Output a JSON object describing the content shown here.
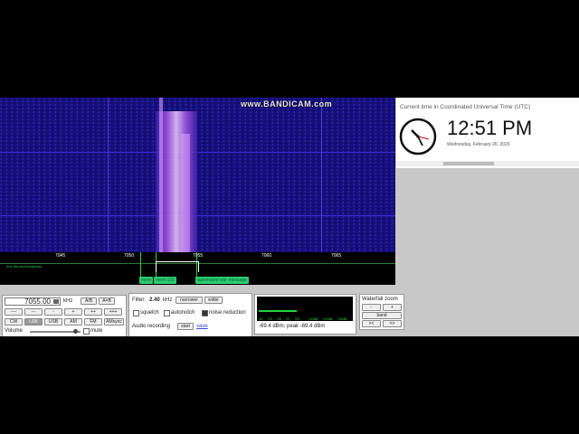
{
  "watermark": "www.BANDICAM.com",
  "frequency_scale": {
    "ticks": [
      "7045",
      "7050",
      "7055",
      "7060",
      "7065"
    ],
    "dx_label": "4ns Illinoind Amateurs"
  },
  "markers": {
    "mem1": "mem",
    "mem2": "mem 120",
    "war": "automated war message"
  },
  "clock": {
    "title": "Current time in Coordinated Universal Time (UTC)",
    "time": "12:51 PM",
    "date": "Wednesday, February 26, 2020"
  },
  "controls": {
    "frequency_value": "7055.00",
    "unit": "kHz",
    "ab": "A/B",
    "a_eq_b": "A=B",
    "step_buttons": [
      "----",
      "---",
      "-",
      "+",
      "++",
      "+++"
    ],
    "modes": [
      "CW",
      "LSB",
      "USB",
      "AM",
      "FM",
      "AMsync"
    ],
    "active_mode": "LSB",
    "volume_label": "Volume",
    "volume_level": 0.95,
    "mute_label": "mute"
  },
  "filter": {
    "label": "Filter:",
    "bandwidth": "2.40",
    "unit": "kHz",
    "narrower": "narrower",
    "wider": "wider",
    "squelch": "squelch",
    "autonotch": "autonotch",
    "noise_reduction": "noise reduction",
    "noise_reduction_checked": true,
    "audio_label": "Audio recording",
    "start": "start",
    "save": "save"
  },
  "smeter": {
    "scale": [
      "S1",
      "S3",
      "S5",
      "S7",
      "S9",
      "+10dB",
      "+20dB",
      "+30dB"
    ],
    "reading": "-69.4 dBm; peak  -69.4 dBm",
    "level": 0.42
  },
  "zoom": {
    "title": "Waterfall zoom",
    "minus": "-",
    "plus": "+",
    "band": "band",
    "left": "><",
    "right": "<>"
  }
}
